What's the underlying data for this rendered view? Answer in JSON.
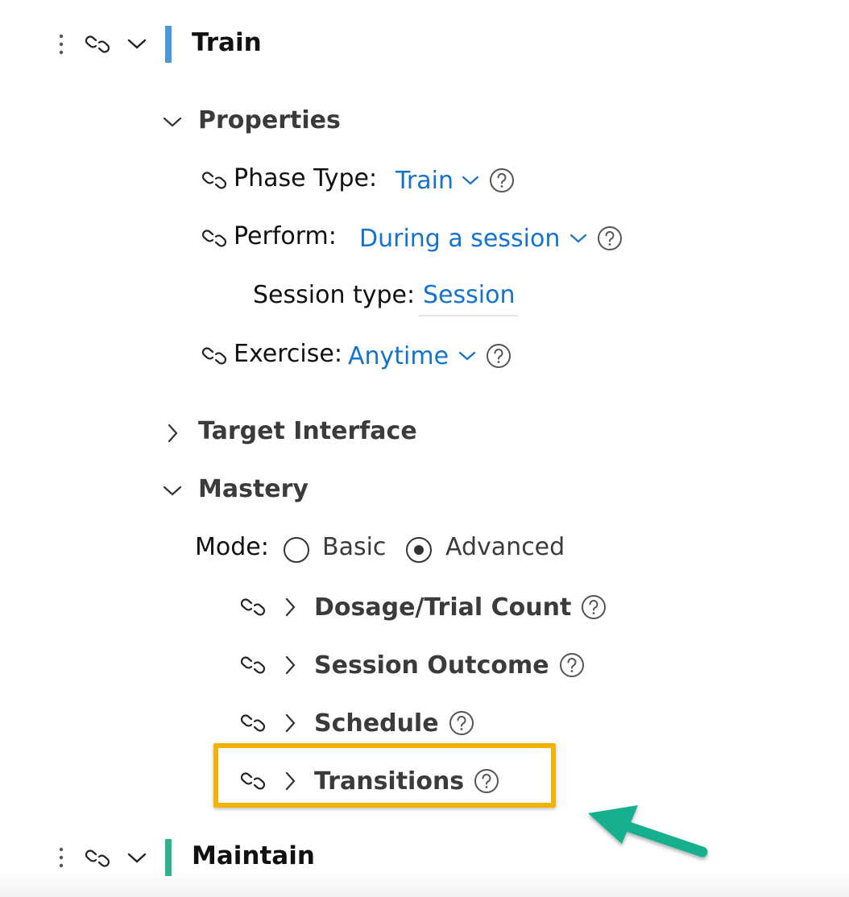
{
  "colors": {
    "accent_blue": "#1473d0",
    "train_bar": "#4a97e0",
    "maintain_bar": "#2bb38d",
    "highlight_border": "#f6b200",
    "arrow": "#19b08f"
  },
  "train_phase": {
    "title": "Train",
    "properties": {
      "title": "Properties",
      "phase_type": {
        "label": "Phase Type:",
        "value": "Train"
      },
      "perform": {
        "label": "Perform:",
        "value": "During a session"
      },
      "session_type": {
        "label": "Session type:",
        "value": "Session"
      },
      "exercise": {
        "label": "Exercise:",
        "value": "Anytime"
      }
    },
    "target_interface": {
      "title": "Target Interface"
    },
    "mastery": {
      "title": "Mastery",
      "mode_label": "Mode:",
      "mode_options": [
        "Basic",
        "Advanced"
      ],
      "selected_mode": "Advanced",
      "items": [
        {
          "label": "Dosage/Trial Count"
        },
        {
          "label": "Session Outcome"
        },
        {
          "label": "Schedule"
        },
        {
          "label": "Transitions"
        }
      ]
    }
  },
  "maintain_phase": {
    "title": "Maintain"
  },
  "icons": {
    "drag_handle": "vertical-dots-icon",
    "link": "link-icon",
    "expand": "chevron-down-icon",
    "collapsed": "chevron-right-icon",
    "help": "question-circle-icon",
    "annotation": "green-arrow"
  }
}
